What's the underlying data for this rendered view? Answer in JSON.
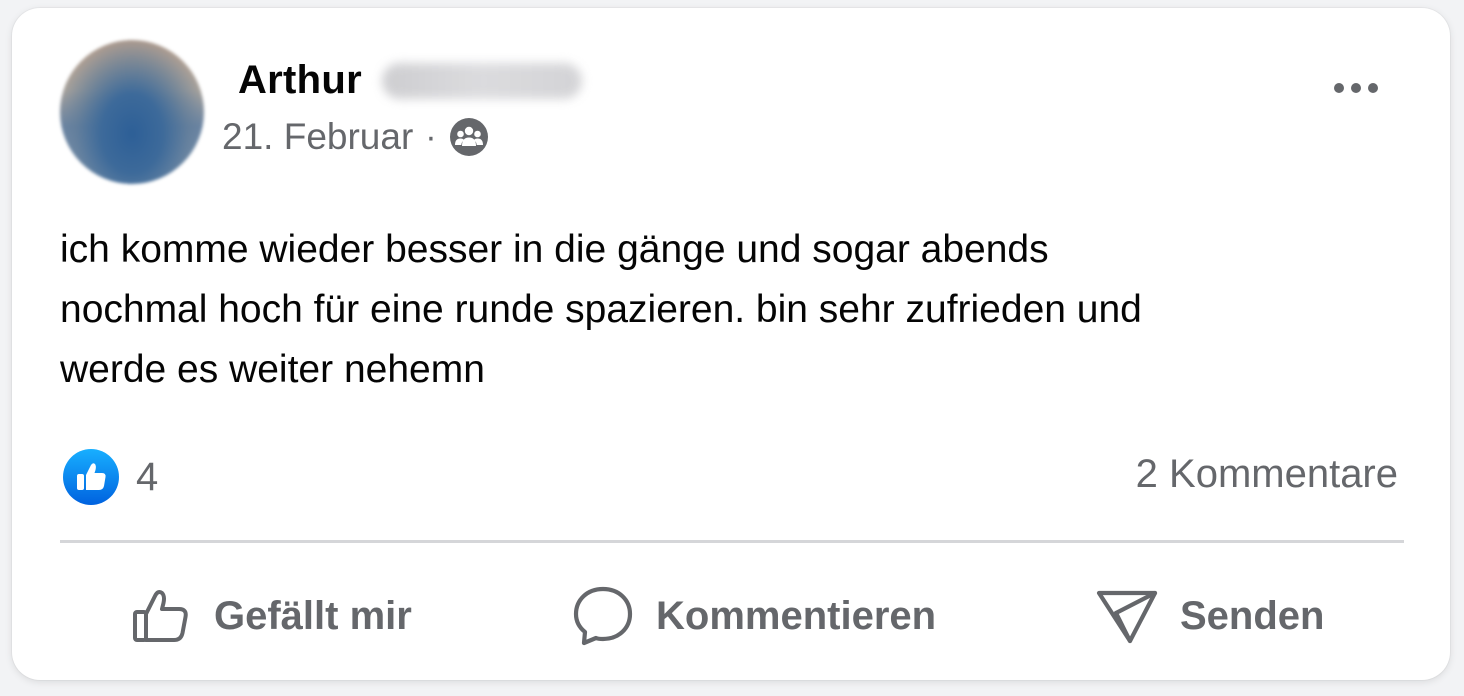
{
  "post": {
    "author_first_name": "Arthur",
    "date": "21. Februar",
    "separator": "·",
    "audience_icon": "group-icon",
    "text": "ich komme wieder besser in die gänge und sogar abends\nnochmal hoch für eine runde spazieren. bin sehr zufrieden und\nwerde es weiter nehemn",
    "like_count": "4",
    "comments_label": "2 Kommentare"
  },
  "actions": {
    "like_label": "Gefällt mir",
    "comment_label": "Kommentieren",
    "send_label": "Senden"
  },
  "icons": {
    "more": "more-horizontal-icon",
    "like_badge": "like-badge-icon",
    "like": "thumbs-up-icon",
    "comment": "comment-bubble-icon",
    "send": "send-icon"
  },
  "colors": {
    "like_blue": "#1877f2",
    "secondary_text": "#65676b",
    "primary_text": "#050505",
    "divider": "#d5d6d9"
  }
}
